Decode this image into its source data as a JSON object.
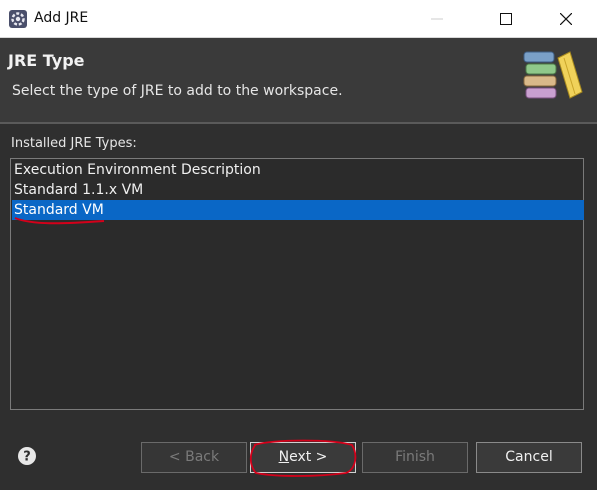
{
  "window": {
    "title": "Add JRE",
    "icon": "eclipse-gear-icon"
  },
  "header": {
    "title": "JRE Type",
    "description": "Select the type of JRE to add to the workspace.",
    "image": "library-books-icon"
  },
  "body": {
    "list_label": "Installed JRE Types:",
    "jre_types": [
      {
        "label": "Execution Environment Description",
        "selected": false
      },
      {
        "label": "Standard 1.1.x VM",
        "selected": false
      },
      {
        "label": "Standard VM",
        "selected": true
      }
    ]
  },
  "footer": {
    "help_icon": "question-icon",
    "back_label": "< Back",
    "next_mnemonic": "N",
    "next_rest": "ext >",
    "finish_label": "Finish",
    "cancel_label": "Cancel"
  },
  "colors": {
    "selection": "#0a67c6",
    "annotation": "#d4001a"
  }
}
